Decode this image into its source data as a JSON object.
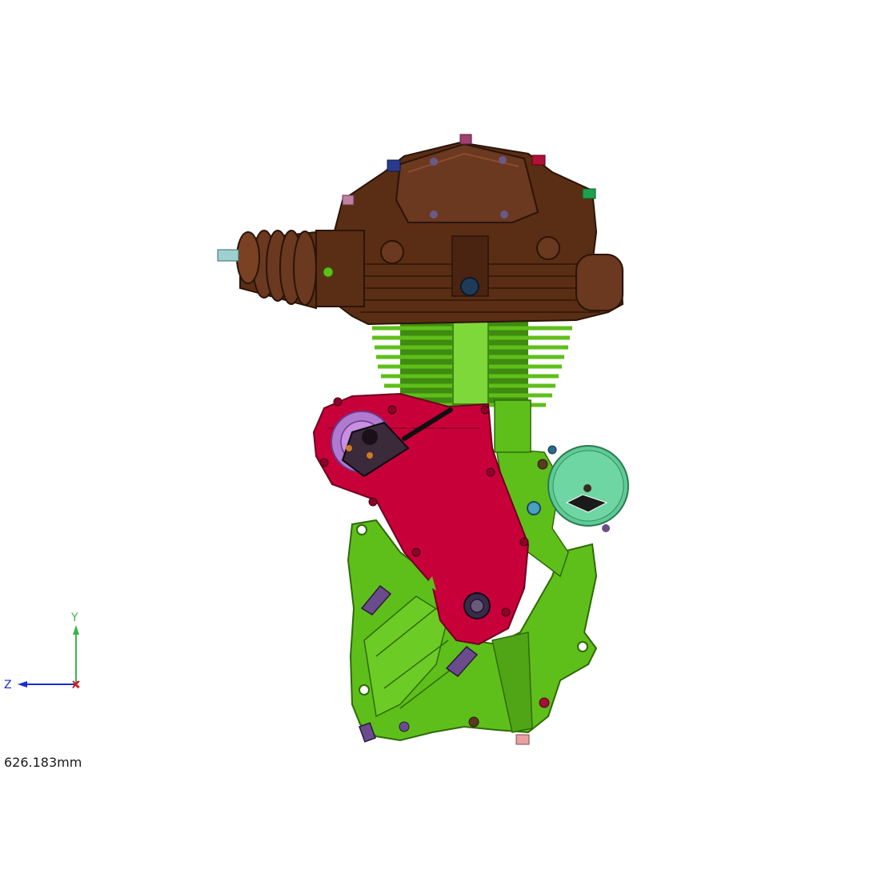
{
  "scene": {
    "scale_readout": "626.183mm",
    "triad": {
      "x_label": "X",
      "y_label": "Y",
      "z_label": "Z"
    }
  },
  "colors": {
    "background": "#ffffff",
    "cylinder_head": "#5a2e14",
    "cylinder_head_light": "#7a4222",
    "crankcase": "#5fbf1a",
    "crankcase_dark": "#3f8a10",
    "timing_cover": "#c8003a",
    "timing_cover_dark": "#8e0028",
    "magneto_disc": "#5ecb96",
    "purple_parts": "#6a4c8c",
    "axis_x": "#d41c1c",
    "axis_y": "#39b54a",
    "axis_z": "#1b2bd6"
  }
}
